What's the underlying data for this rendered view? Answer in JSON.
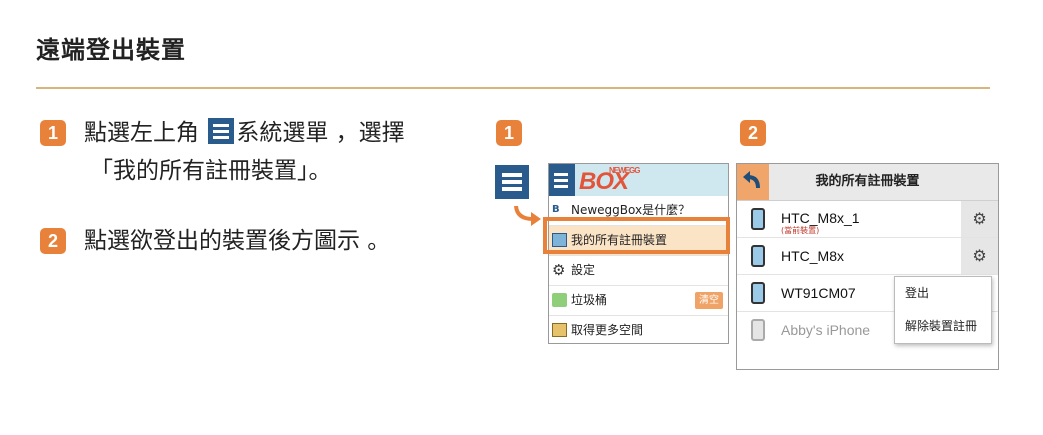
{
  "page": {
    "title": "遠端登出裝置"
  },
  "steps": [
    {
      "badge": "1",
      "line1a": "點選左上角",
      "line1b": "系統選單 ，選擇",
      "line2": "「我的所有註冊裝置」。"
    },
    {
      "badge": "2",
      "text": "點選欲登出的裝置後方圖示 。"
    }
  ],
  "figures": {
    "badge1": "1",
    "badge2": "2"
  },
  "app_menu": {
    "logo": "BOX",
    "logo_tag": "NEWEGG",
    "items": [
      {
        "label": "NeweggBox是什麼？",
        "icon": "box-logo-icon"
      },
      {
        "label": "我的所有註冊裝置",
        "icon": "devices-icon"
      },
      {
        "label": "設定",
        "icon": "gear-icon"
      },
      {
        "label": "垃圾桶",
        "icon": "recycle-bin-icon",
        "button": "清空"
      },
      {
        "label": "取得更多空間",
        "icon": "storage-icon"
      }
    ]
  },
  "devices_screen": {
    "title": "我的所有註冊裝置",
    "devices": [
      {
        "name": "HTC_M8x_1",
        "sub": "(當前裝置)"
      },
      {
        "name": "HTC_M8x",
        "sub": ""
      },
      {
        "name": "WT91CM07",
        "sub": ""
      },
      {
        "name": "Abby's iPhone",
        "sub": ""
      }
    ],
    "popup": [
      "登出",
      "解除裝置註冊"
    ]
  },
  "colors": {
    "accent": "#e8823a",
    "menu_blue": "#2a5b8d",
    "rule": "#d9b57e"
  }
}
